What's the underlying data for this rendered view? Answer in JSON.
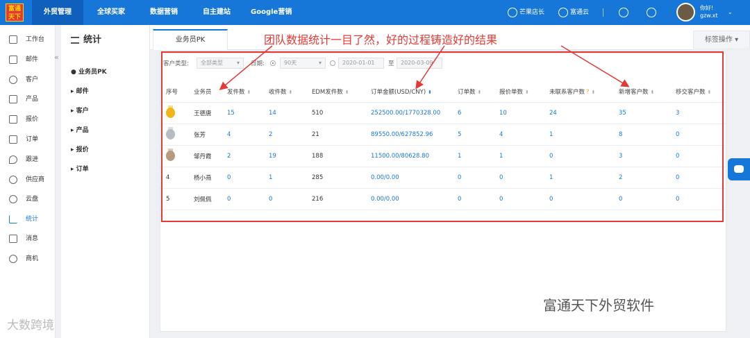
{
  "logo": {
    "text": "富通天下"
  },
  "topnav": {
    "items": [
      "外贸管理",
      "全球买家",
      "数据营销",
      "自主建站",
      "Google营销"
    ]
  },
  "topbar_right": {
    "mango": "芒果店长",
    "cloud": "富通云",
    "greeting": "你好!",
    "username": "gzw.xt"
  },
  "sidebar": {
    "items": [
      "工作台",
      "邮件",
      "客户",
      "产品",
      "报价",
      "订单",
      "跟进",
      "供应商",
      "云盘",
      "统计",
      "消息",
      "商机"
    ],
    "active": "统计"
  },
  "panel2": {
    "title": "统计",
    "items": [
      "业务员PK",
      "邮件",
      "客户",
      "产品",
      "报价",
      "订单"
    ]
  },
  "tabs": {
    "active": "业务员PK",
    "tag_operation": "标签操作"
  },
  "filters": {
    "customer_type_label": "客户类型:",
    "customer_type_value": "全部类型",
    "date_label": "日期:",
    "period_value": "90天",
    "date_from": "2020-01-01",
    "to_label": "至",
    "date_to": "2020-03-09"
  },
  "table": {
    "headers": [
      "序号",
      "业务员",
      "发件数",
      "收件数",
      "EDM发件数",
      "订单金额(USD/CNY)",
      "订单数",
      "报价单数",
      "未联系客户数",
      "新增客户数",
      "移交客户数"
    ],
    "rows": [
      {
        "rank": "1",
        "name": "王德唐",
        "sent": "15",
        "received": "14",
        "edm": "510",
        "amount": "252500.00/1770328.00",
        "orders": "6",
        "quotes": "10",
        "uncontacted": "24",
        "new_customers": "35",
        "transferred": "3"
      },
      {
        "rank": "2",
        "name": "张芳",
        "sent": "4",
        "received": "2",
        "edm": "21",
        "amount": "89550.00/627852.96",
        "orders": "5",
        "quotes": "4",
        "uncontacted": "1",
        "new_customers": "8",
        "transferred": "0"
      },
      {
        "rank": "3",
        "name": "邹丹霞",
        "sent": "2",
        "received": "19",
        "edm": "188",
        "amount": "11500.00/80628.80",
        "orders": "1",
        "quotes": "1",
        "uncontacted": "0",
        "new_customers": "3",
        "transferred": "0"
      },
      {
        "rank": "4",
        "name": "杨小燕",
        "sent": "0",
        "received": "1",
        "edm": "285",
        "amount": "0.00/0.00",
        "orders": "0",
        "quotes": "0",
        "uncontacted": "1",
        "new_customers": "2",
        "transferred": "0"
      },
      {
        "rank": "5",
        "name": "刘佩佩",
        "sent": "0",
        "received": "0",
        "edm": "216",
        "amount": "0.00/0.00",
        "orders": "0",
        "quotes": "0",
        "uncontacted": "0",
        "new_customers": "0",
        "transferred": "0"
      }
    ]
  },
  "annotation": {
    "text": "团队数据统计一目了然，好的过程铸造好的结果",
    "color": "#e53935"
  },
  "watermarks": {
    "right": "富通天下外贸软件",
    "left": "大数跨境"
  },
  "colors": {
    "primary": "#1677d9",
    "annotation": "#e53935"
  }
}
